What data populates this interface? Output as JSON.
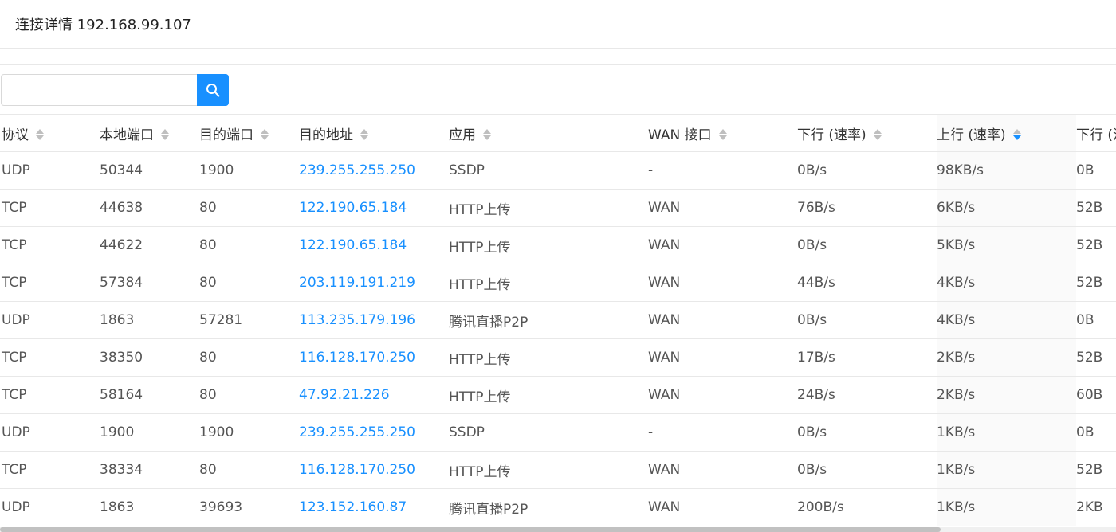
{
  "header": {
    "title": "连接详情 192.168.99.107"
  },
  "search": {
    "value": "",
    "placeholder": ""
  },
  "table": {
    "columns": [
      {
        "label": "协议"
      },
      {
        "label": "本地端口"
      },
      {
        "label": "目的端口"
      },
      {
        "label": "目的地址"
      },
      {
        "label": "应用"
      },
      {
        "label": "WAN 接口"
      },
      {
        "label": "下行 (速率)"
      },
      {
        "label": "上行 (速率)",
        "sorted": "descending"
      },
      {
        "label": "下行 (流"
      }
    ],
    "rows": [
      {
        "protocol": "UDP",
        "local_port": "50344",
        "dest_port": "1900",
        "dest_addr": "239.255.255.250",
        "app": "SSDP",
        "wan": "-",
        "down_rate": "0B/s",
        "up_rate": "98KB/s",
        "down_total": "0B"
      },
      {
        "protocol": "TCP",
        "local_port": "44638",
        "dest_port": "80",
        "dest_addr": "122.190.65.184",
        "app": "HTTP上传",
        "wan": "WAN",
        "down_rate": "76B/s",
        "up_rate": "6KB/s",
        "down_total": "52B"
      },
      {
        "protocol": "TCP",
        "local_port": "44622",
        "dest_port": "80",
        "dest_addr": "122.190.65.184",
        "app": "HTTP上传",
        "wan": "WAN",
        "down_rate": "0B/s",
        "up_rate": "5KB/s",
        "down_total": "52B"
      },
      {
        "protocol": "TCP",
        "local_port": "57384",
        "dest_port": "80",
        "dest_addr": "203.119.191.219",
        "app": "HTTP上传",
        "wan": "WAN",
        "down_rate": "44B/s",
        "up_rate": "4KB/s",
        "down_total": "52B"
      },
      {
        "protocol": "UDP",
        "local_port": "1863",
        "dest_port": "57281",
        "dest_addr": "113.235.179.196",
        "app": "腾讯直播P2P",
        "wan": "WAN",
        "down_rate": "0B/s",
        "up_rate": "4KB/s",
        "down_total": "0B"
      },
      {
        "protocol": "TCP",
        "local_port": "38350",
        "dest_port": "80",
        "dest_addr": "116.128.170.250",
        "app": "HTTP上传",
        "wan": "WAN",
        "down_rate": "17B/s",
        "up_rate": "2KB/s",
        "down_total": "52B"
      },
      {
        "protocol": "TCP",
        "local_port": "58164",
        "dest_port": "80",
        "dest_addr": "47.92.21.226",
        "app": "HTTP上传",
        "wan": "WAN",
        "down_rate": "24B/s",
        "up_rate": "2KB/s",
        "down_total": "60B"
      },
      {
        "protocol": "UDP",
        "local_port": "1900",
        "dest_port": "1900",
        "dest_addr": "239.255.255.250",
        "app": "SSDP",
        "wan": "-",
        "down_rate": "0B/s",
        "up_rate": "1KB/s",
        "down_total": "0B"
      },
      {
        "protocol": "TCP",
        "local_port": "38334",
        "dest_port": "80",
        "dest_addr": "116.128.170.250",
        "app": "HTTP上传",
        "wan": "WAN",
        "down_rate": "0B/s",
        "up_rate": "1KB/s",
        "down_total": "52B"
      },
      {
        "protocol": "UDP",
        "local_port": "1863",
        "dest_port": "39693",
        "dest_addr": "123.152.160.87",
        "app": "腾讯直播P2P",
        "wan": "WAN",
        "down_rate": "200B/s",
        "up_rate": "1KB/s",
        "down_total": "2KB"
      }
    ]
  },
  "colors": {
    "accent": "#1890ff",
    "border": "#e8e8e8"
  },
  "icons": {
    "search_button": "search-icon",
    "sorter": "sort-caret-icon"
  }
}
